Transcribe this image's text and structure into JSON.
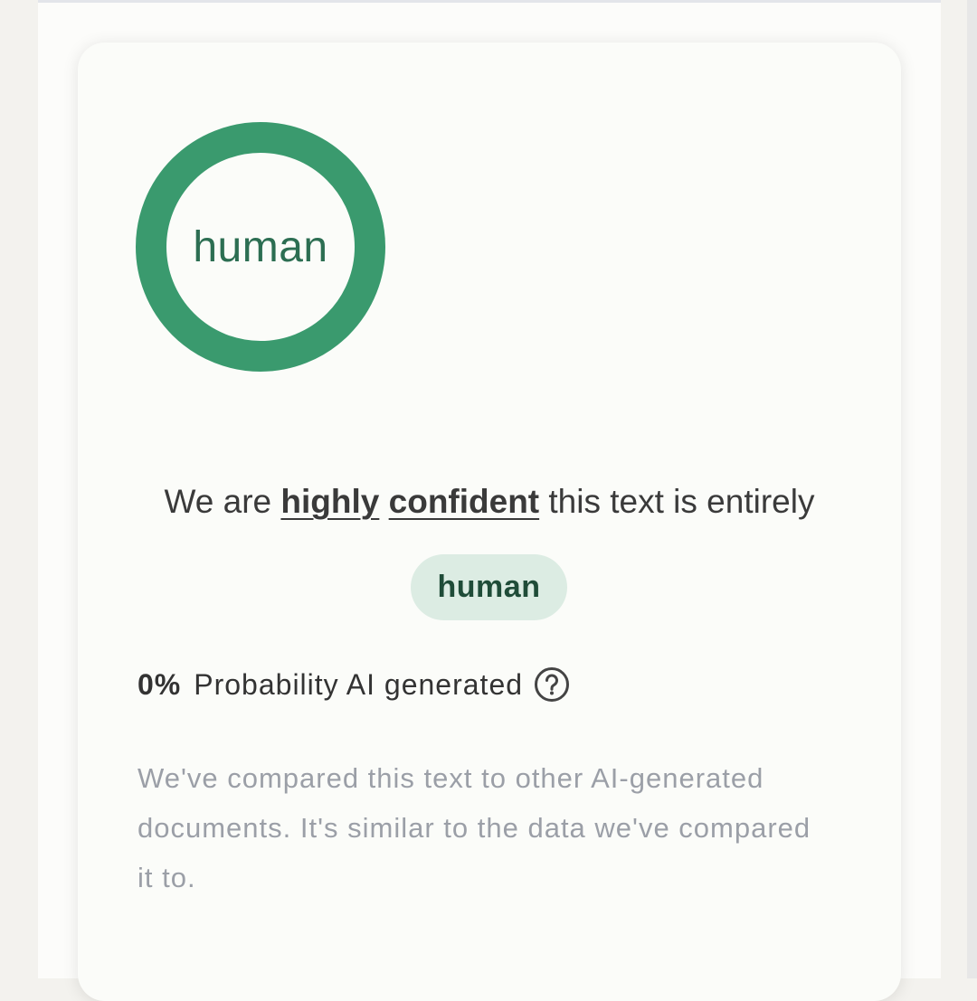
{
  "colors": {
    "ring": "#3a9a6e",
    "ring_text": "#2c6e52",
    "badge_bg": "#dcece3",
    "badge_text": "#1f4c38",
    "body_text": "#3a3a3a",
    "muted_text": "#9b9fa7"
  },
  "result": {
    "ring_label": "human",
    "ring_fill_fraction": 1.0,
    "confidence": {
      "prefix": "We are",
      "word1": "highly",
      "word2": "confident",
      "suffix": "this text is entirely"
    },
    "badge_label": "human",
    "probability": {
      "value": "0%",
      "label": "Probability AI generated",
      "help_icon": "question-circle-icon"
    },
    "explanation": "We've compared this text to other AI-generated documents. It's similar to the data we've compared it to."
  }
}
